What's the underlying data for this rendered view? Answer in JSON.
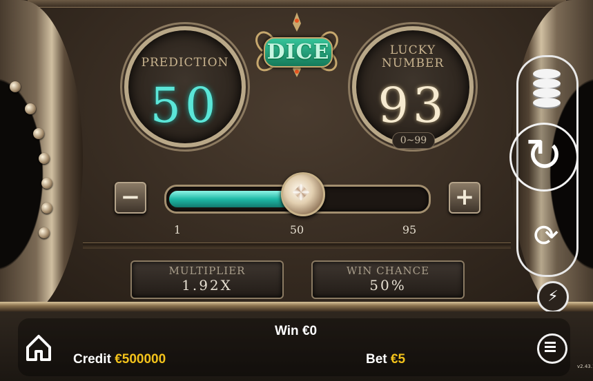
{
  "game": {
    "logo_text": "DICE"
  },
  "prediction": {
    "label_line1": "PREDICTION",
    "value": "50"
  },
  "lucky_number": {
    "label_line1": "LUCKY",
    "label_line2": "NUMBER",
    "value": "93",
    "range": "0~99"
  },
  "slider": {
    "minus_symbol": "−",
    "plus_symbol": "+",
    "min_label": "1",
    "mid_label": "50",
    "max_label": "95",
    "min": 1,
    "max": 95,
    "value": 50
  },
  "multiplier": {
    "label": "MULTIPLIER",
    "value": "1.92X"
  },
  "win_chance": {
    "label": "WIN CHANCE",
    "value": "50%"
  },
  "controls": {
    "spin_symbol": "↻",
    "auto_symbol": "⟳",
    "turbo_symbol": "⚡"
  },
  "footer": {
    "win_label": "Win",
    "win_value": "€0",
    "credit_label": "Credit",
    "credit_value": "€500000",
    "bet_label": "Bet",
    "bet_value": "€5",
    "version": "v2.43.1"
  },
  "colors": {
    "prediction": "#5be6d8",
    "credit_value": "#f2c21b",
    "slider_fill": "#1fb9a6"
  }
}
